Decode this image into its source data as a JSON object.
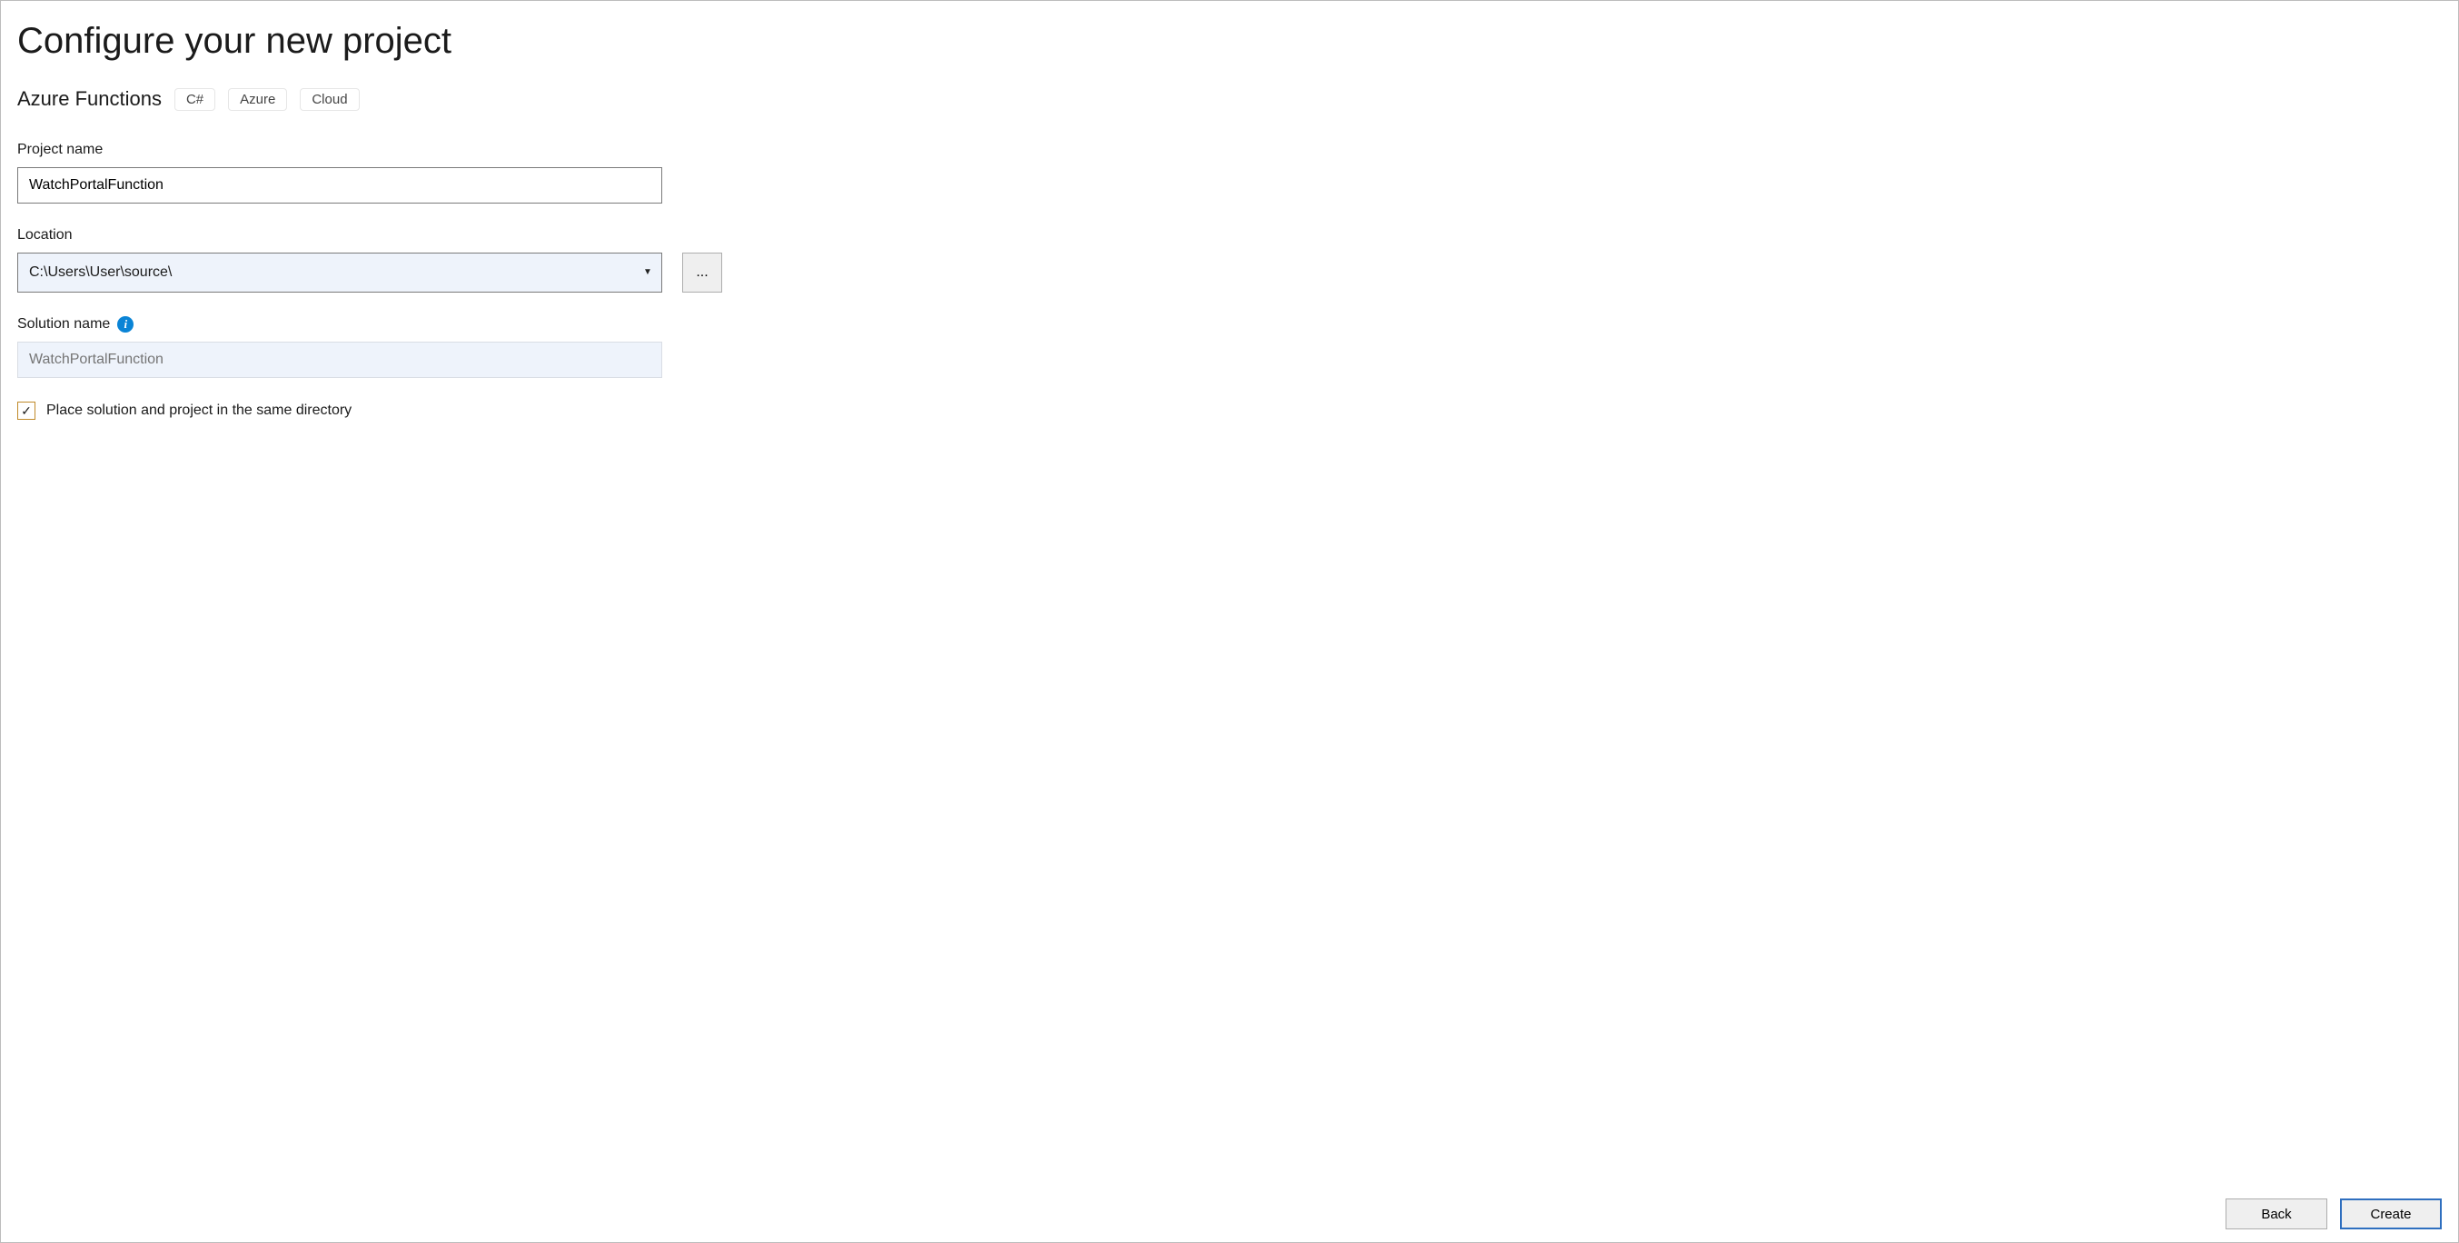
{
  "header": {
    "title": "Configure your new project",
    "subtitle": "Azure Functions",
    "tags": [
      "C#",
      "Azure",
      "Cloud"
    ]
  },
  "fields": {
    "project_name": {
      "label": "Project name",
      "value": "WatchPortalFunction"
    },
    "location": {
      "label": "Location",
      "value": "C:\\Users\\User\\source\\",
      "browse_label": "..."
    },
    "solution_name": {
      "label": "Solution name",
      "placeholder": "WatchPortalFunction"
    },
    "same_dir": {
      "label": "Place solution and project in the same directory",
      "checked": true
    }
  },
  "footer": {
    "back": "Back",
    "create": "Create"
  }
}
